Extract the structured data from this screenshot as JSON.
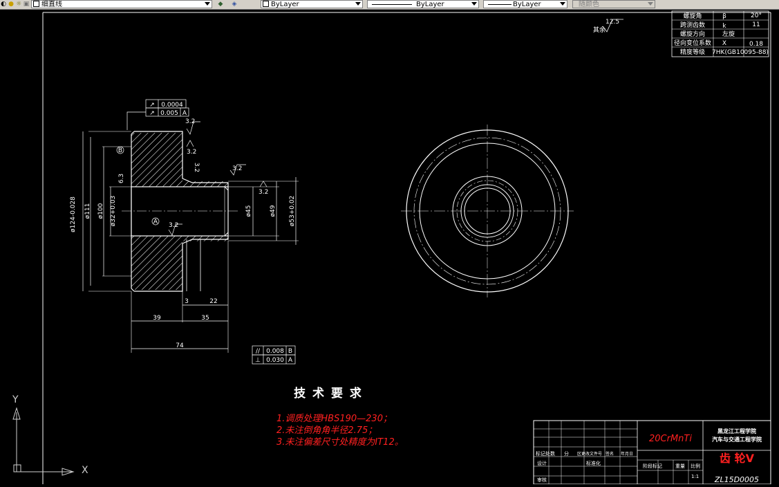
{
  "toolbar": {
    "layer_name": "细直线",
    "color": "ByLayer",
    "linetype": "ByLayer",
    "lineweight": "ByLayer",
    "plotstyle": "随颜色"
  },
  "colors": {
    "background": "#000000",
    "lines": "#ffffff",
    "note_red": "#ff2020",
    "ucs_gray": "#cfcfcf"
  },
  "params_table": [
    {
      "label": "螺旋角",
      "symbol": "β",
      "value": "20°"
    },
    {
      "label": "跨测齿数",
      "symbol": "k",
      "value": "11"
    },
    {
      "label": "螺旋方向",
      "symbol": "左旋",
      "value": ""
    },
    {
      "label": "径向变位系数",
      "symbol": "X",
      "value": "0.18"
    },
    {
      "label": "精度等级",
      "symbol": "7HK(GB10095-88)",
      "value": ""
    }
  ],
  "roughness_other": {
    "value": "12.5",
    "label": "其余"
  },
  "section_view": {
    "gdt_top": [
      {
        "symbol": "↗",
        "value": "0.0004"
      },
      {
        "symbol": "↗",
        "value": "0.005",
        "datum": "A"
      }
    ],
    "gdt_bottom": [
      {
        "symbol": "//",
        "value": "0.008",
        "datum": "B"
      },
      {
        "symbol": "⊥",
        "value": "0.030",
        "datum": "A"
      }
    ],
    "roughness": [
      "3.2",
      "3.2",
      "3.2",
      "3.2",
      "3.2",
      "6.3",
      "3.2",
      "3.2"
    ],
    "datum_labels": [
      "B",
      "A"
    ],
    "diameters": [
      "ø124-0.028",
      "ø111",
      "ø100",
      "ø32+0.03",
      "ø45",
      "ø49",
      "ø53+0.02"
    ],
    "lengths": [
      "3",
      "22",
      "39",
      "35",
      "74"
    ]
  },
  "notes": {
    "title": "技 术 要 求",
    "items": [
      "1.调质处理HBS190—230；",
      "2.未注倒角角半径2.75；",
      "3.未注偏差尺寸处精度为IT12。"
    ]
  },
  "title_block": {
    "material": "20CrMnTi",
    "school_1": "黑龙江工程学院",
    "school_2": "汽车与交通工程学院",
    "part_name": "齿 轮V",
    "drawing_no": "ZL15D0005",
    "row_labels": [
      "标记处数",
      "分",
      "区更改文件号",
      "签名",
      "年月日"
    ],
    "design": "设计",
    "standardize": "标准化",
    "review": "审核",
    "stage_mark": "阶段标记",
    "weight": "重量",
    "scale": "比例",
    "scale_value": "1:1"
  },
  "ucs": {
    "x_label": "X",
    "y_label": "Y"
  }
}
